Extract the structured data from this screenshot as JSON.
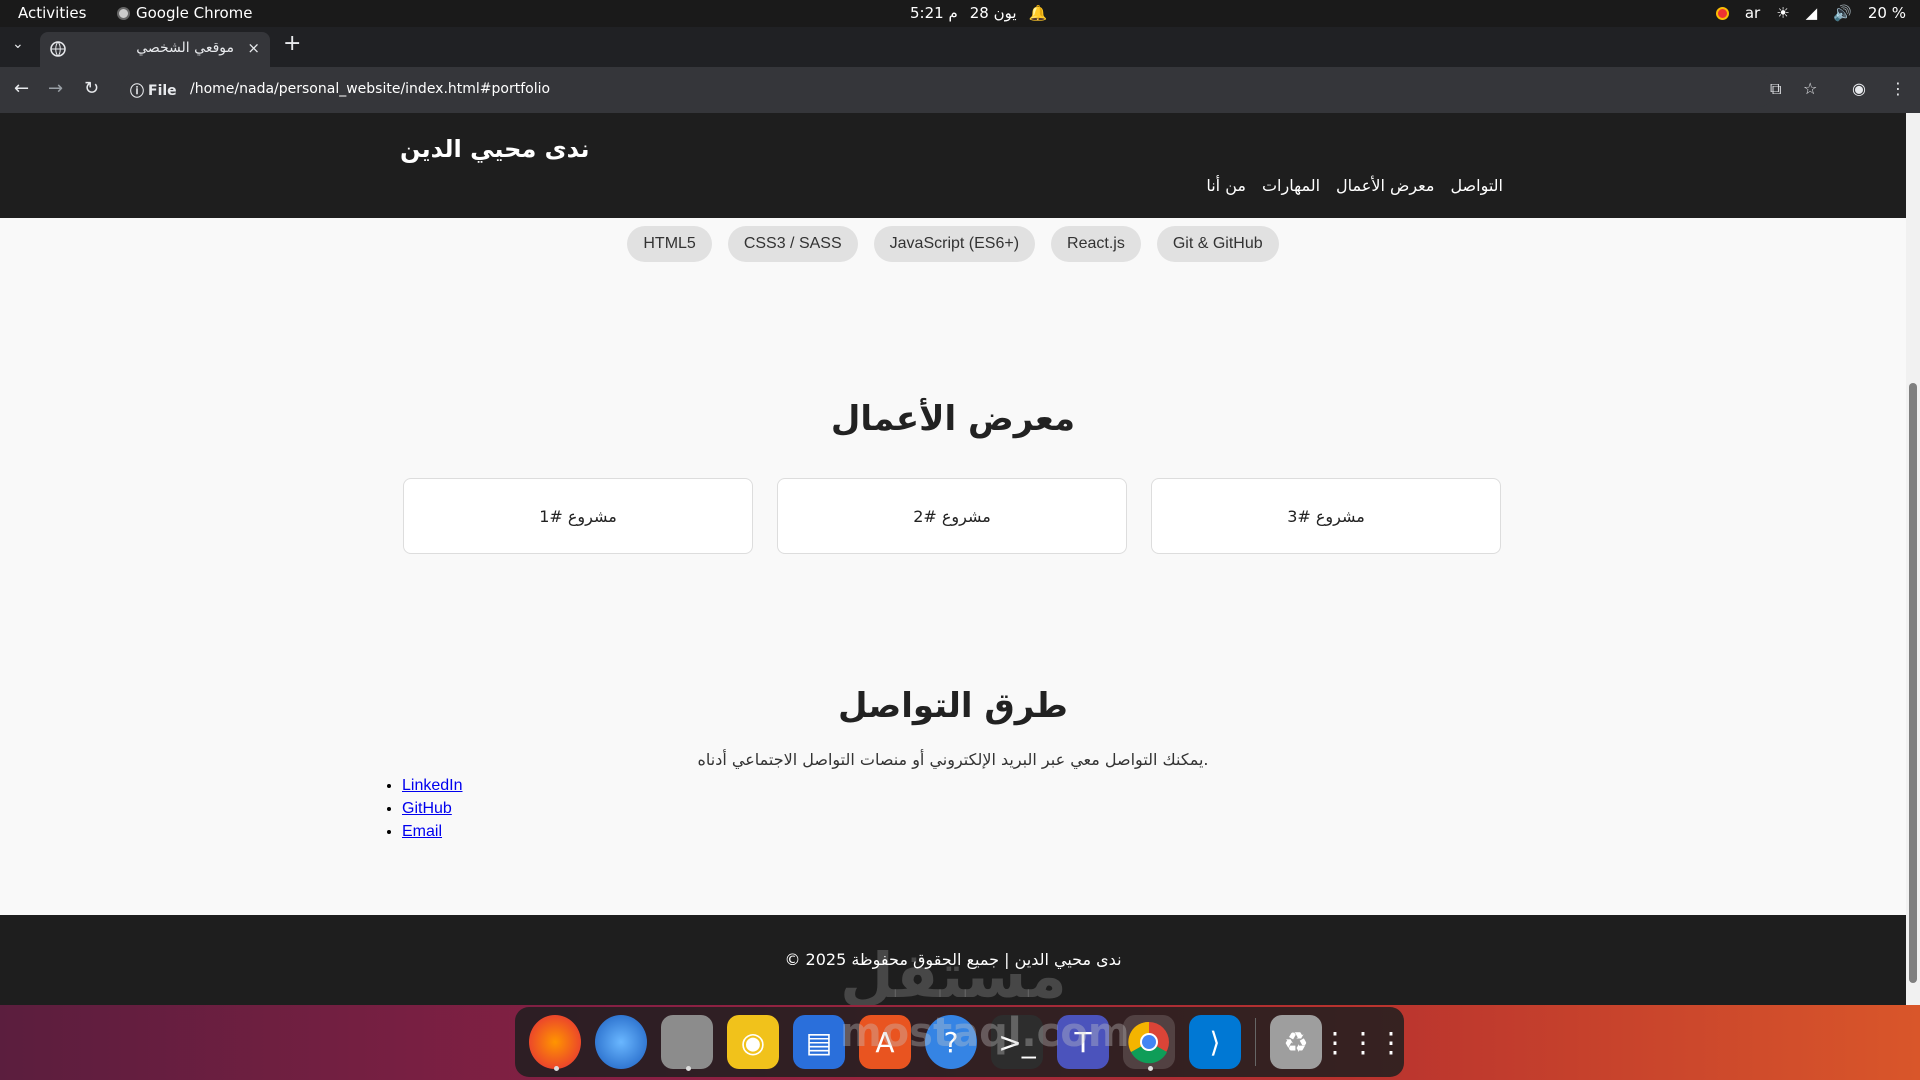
{
  "system": {
    "activities": "Activities",
    "app_name": "Google Chrome",
    "clock_date": "28 يون",
    "clock_time": "5:21 م",
    "lang": "ar",
    "battery": "20 %"
  },
  "browser": {
    "tab_title": "موقعي الشخصي",
    "tab_close": "×",
    "new_tab": "+",
    "url_scheme": "File",
    "url": "/home/nada/personal_website/index.html#portfolio"
  },
  "site": {
    "title": "ندى محيي الدين",
    "nav": [
      "التواصل",
      "معرض الأعمال",
      "المهارات",
      "من أنا"
    ],
    "skills": [
      "HTML5",
      "CSS3 / SASS",
      "JavaScript (ES6+)",
      "React.js",
      "Git & GitHub"
    ],
    "portfolio_title": "معرض الأعمال",
    "projects": [
      "مشروع #3",
      "مشروع #2",
      "مشروع #1"
    ],
    "contact_title": "طرق التواصل",
    "contact_desc": "يمكنك التواصل معي عبر البريد الإلكتروني أو منصات التواصل الاجتماعي أدناه.",
    "contact_links": [
      "LinkedIn",
      "GitHub",
      "Email"
    ],
    "footer": "ندى محيي الدين | جميع الحقوق محفوظة 2025 ©",
    "watermark": "مستقل",
    "watermark_sub": "mostaql.com"
  },
  "dock": {
    "apps": [
      "firefox-icon",
      "thunderbird-icon",
      "files-icon",
      "rhythmbox-icon",
      "writer-icon",
      "app-center-icon",
      "help-icon",
      "terminal-icon",
      "typst-icon",
      "chrome-icon",
      "vscode-icon",
      "trash-icon",
      "app-grid-icon"
    ]
  },
  "colors": {
    "header_bg": "#1e1e1e",
    "page_bg": "#f9f9f9",
    "pill_bg": "#e1e1e1",
    "link": "#0000ee"
  }
}
